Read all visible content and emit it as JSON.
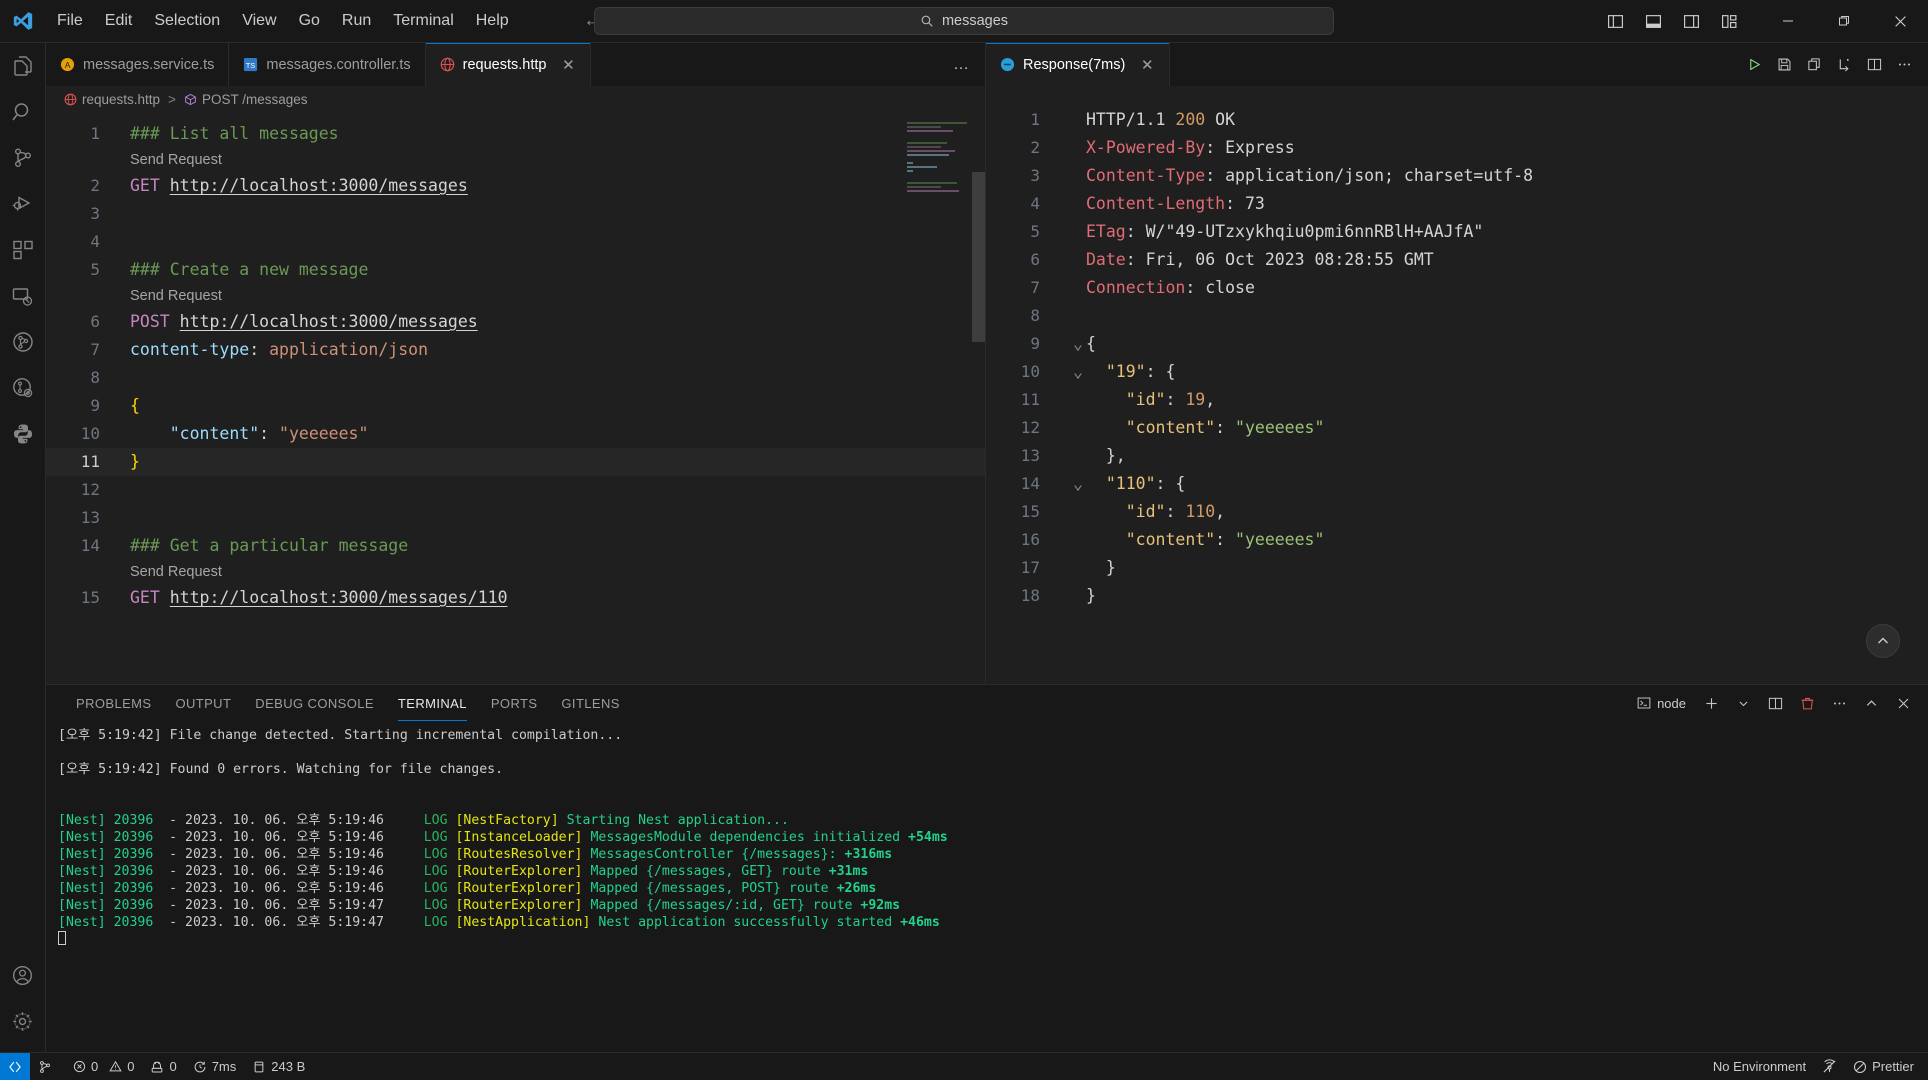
{
  "titlebar": {
    "menus": [
      "File",
      "Edit",
      "Selection",
      "View",
      "Go",
      "Run",
      "Terminal",
      "Help"
    ],
    "nav_back": "←",
    "nav_forward": "→",
    "command_center_text": "messages",
    "layout_icons": [
      "toggle-primary-sidebar",
      "toggle-panel",
      "toggle-secondary-sidebar",
      "customize-layout"
    ],
    "window_controls": {
      "minimize": "—",
      "maximize": "▢",
      "close": "✕"
    }
  },
  "activitybar": {
    "items": [
      {
        "name": "explorer"
      },
      {
        "name": "search"
      },
      {
        "name": "source-control"
      },
      {
        "name": "run-and-debug"
      },
      {
        "name": "extensions"
      },
      {
        "name": "remote-explorer"
      },
      {
        "name": "gitlens"
      },
      {
        "name": "gitlens-inspect"
      },
      {
        "name": "python"
      }
    ],
    "bottom": [
      {
        "name": "accounts"
      },
      {
        "name": "settings"
      }
    ]
  },
  "editor_left": {
    "tabs": [
      {
        "label": "messages.service.ts",
        "icon": "angular-file-icon",
        "active": false,
        "dirty": false
      },
      {
        "label": "messages.controller.ts",
        "icon": "typescript-file-icon",
        "active": false,
        "dirty": false
      },
      {
        "label": "requests.http",
        "icon": "http-file-icon",
        "active": true,
        "close": "✕"
      }
    ],
    "more_actions": "…",
    "breadcrumb": {
      "file": "requests.http",
      "separator": ">",
      "symbol": "POST /messages"
    },
    "lines": [
      {
        "num": "1",
        "codelens": null,
        "tokens": [
          {
            "t": "### List all messages",
            "c": "s-comment"
          }
        ]
      },
      {
        "num": "",
        "codelens": "Send Request",
        "tokens": []
      },
      {
        "num": "2",
        "codelens": null,
        "tokens": [
          {
            "t": "GET ",
            "c": "s-method"
          },
          {
            "t": "http://localhost:3000/messages",
            "c": "s-url"
          }
        ]
      },
      {
        "num": "3",
        "codelens": null,
        "tokens": []
      },
      {
        "num": "4",
        "codelens": null,
        "tokens": []
      },
      {
        "num": "5",
        "codelens": null,
        "tokens": [
          {
            "t": "### Create a new message",
            "c": "s-comment"
          }
        ]
      },
      {
        "num": "",
        "codelens": "Send Request",
        "tokens": []
      },
      {
        "num": "6",
        "codelens": null,
        "tokens": [
          {
            "t": "POST ",
            "c": "s-method"
          },
          {
            "t": "http://localhost:3000/messages",
            "c": "s-url"
          }
        ]
      },
      {
        "num": "7",
        "codelens": null,
        "tokens": [
          {
            "t": "content-type",
            "c": "s-header"
          },
          {
            "t": ": ",
            "c": "s-plain"
          },
          {
            "t": "application/json",
            "c": "s-headerv"
          }
        ]
      },
      {
        "num": "8",
        "codelens": null,
        "tokens": []
      },
      {
        "num": "9",
        "codelens": null,
        "tokens": [
          {
            "t": "{",
            "c": "s-brace"
          }
        ]
      },
      {
        "num": "10",
        "codelens": null,
        "tokens": [
          {
            "t": "    \"content\"",
            "c": "s-key"
          },
          {
            "t": ": ",
            "c": "s-plain"
          },
          {
            "t": "\"yeeeees\"",
            "c": "s-str"
          }
        ]
      },
      {
        "num": "11",
        "codelens": null,
        "current": true,
        "tokens": [
          {
            "t": "}",
            "c": "s-brace"
          }
        ]
      },
      {
        "num": "12",
        "codelens": null,
        "tokens": []
      },
      {
        "num": "13",
        "codelens": null,
        "tokens": []
      },
      {
        "num": "14",
        "codelens": null,
        "tokens": [
          {
            "t": "### Get a particular message",
            "c": "s-comment"
          }
        ]
      },
      {
        "num": "",
        "codelens": "Send Request",
        "tokens": []
      },
      {
        "num": "15",
        "codelens": null,
        "tokens": [
          {
            "t": "GET ",
            "c": "s-method"
          },
          {
            "t": "http://localhost:3000/messages/110",
            "c": "s-url"
          }
        ]
      }
    ]
  },
  "editor_right": {
    "tab": {
      "label": "Response(7ms)",
      "icon": "response-icon",
      "close": "✕"
    },
    "actions": [
      "run-icon",
      "save-icon",
      "copy-icon",
      "fold-icon",
      "split-editor-icon",
      "more-actions-icon"
    ],
    "lines": [
      {
        "num": "1",
        "tokens": [
          {
            "t": "HTTP/1.1 ",
            "c": "s-resp-plain"
          },
          {
            "t": "200",
            "c": "s-resp-num"
          },
          {
            "t": " OK",
            "c": "s-resp-plain"
          }
        ]
      },
      {
        "num": "2",
        "tokens": [
          {
            "t": "X-Powered-By",
            "c": "s-resp-key"
          },
          {
            "t": ": Express",
            "c": "s-resp-plain"
          }
        ]
      },
      {
        "num": "3",
        "tokens": [
          {
            "t": "Content-Type",
            "c": "s-resp-key"
          },
          {
            "t": ": application/json; charset=utf-8",
            "c": "s-resp-plain"
          }
        ]
      },
      {
        "num": "4",
        "tokens": [
          {
            "t": "Content-Length",
            "c": "s-resp-key"
          },
          {
            "t": ": 73",
            "c": "s-resp-plain"
          }
        ]
      },
      {
        "num": "5",
        "tokens": [
          {
            "t": "ETag",
            "c": "s-resp-key"
          },
          {
            "t": ": W/\"49-UTzxykhqiu0pmi6nnRBlH+AAJfA\"",
            "c": "s-resp-plain"
          }
        ]
      },
      {
        "num": "6",
        "tokens": [
          {
            "t": "Date",
            "c": "s-resp-key"
          },
          {
            "t": ": Fri, 06 Oct 2023 08:28:55 GMT",
            "c": "s-resp-plain"
          }
        ]
      },
      {
        "num": "7",
        "tokens": [
          {
            "t": "Connection",
            "c": "s-resp-key"
          },
          {
            "t": ": close",
            "c": "s-resp-plain"
          }
        ]
      },
      {
        "num": "8",
        "tokens": []
      },
      {
        "num": "9",
        "fold": "v",
        "tokens": [
          {
            "t": "{",
            "c": "s-json-punct"
          }
        ]
      },
      {
        "num": "10",
        "fold": "v",
        "tokens": [
          {
            "t": "  \"19\"",
            "c": "s-json-key"
          },
          {
            "t": ": {",
            "c": "s-json-punct"
          }
        ]
      },
      {
        "num": "11",
        "tokens": [
          {
            "t": "    \"id\"",
            "c": "s-json-key"
          },
          {
            "t": ": ",
            "c": "s-json-punct"
          },
          {
            "t": "19",
            "c": "s-json-num"
          },
          {
            "t": ",",
            "c": "s-json-punct"
          }
        ]
      },
      {
        "num": "12",
        "tokens": [
          {
            "t": "    \"content\"",
            "c": "s-json-key"
          },
          {
            "t": ": ",
            "c": "s-json-punct"
          },
          {
            "t": "\"yeeeees\"",
            "c": "s-json-str"
          }
        ]
      },
      {
        "num": "13",
        "tokens": [
          {
            "t": "  },",
            "c": "s-json-punct"
          }
        ]
      },
      {
        "num": "14",
        "fold": "v",
        "tokens": [
          {
            "t": "  \"110\"",
            "c": "s-json-key"
          },
          {
            "t": ": {",
            "c": "s-json-punct"
          }
        ]
      },
      {
        "num": "15",
        "tokens": [
          {
            "t": "    \"id\"",
            "c": "s-json-key"
          },
          {
            "t": ": ",
            "c": "s-json-punct"
          },
          {
            "t": "110",
            "c": "s-json-num"
          },
          {
            "t": ",",
            "c": "s-json-punct"
          }
        ]
      },
      {
        "num": "16",
        "tokens": [
          {
            "t": "    \"content\"",
            "c": "s-json-key"
          },
          {
            "t": ": ",
            "c": "s-json-punct"
          },
          {
            "t": "\"yeeeees\"",
            "c": "s-json-str"
          }
        ]
      },
      {
        "num": "17",
        "tokens": [
          {
            "t": "  }",
            "c": "s-json-punct"
          }
        ]
      },
      {
        "num": "18",
        "tokens": [
          {
            "t": "}",
            "c": "s-json-punct"
          }
        ]
      }
    ]
  },
  "panel": {
    "tabs": [
      {
        "label": "PROBLEMS",
        "active": false
      },
      {
        "label": "OUTPUT",
        "active": false
      },
      {
        "label": "DEBUG CONSOLE",
        "active": false
      },
      {
        "label": "TERMINAL",
        "active": true
      },
      {
        "label": "PORTS",
        "active": false
      },
      {
        "label": "GITLENS",
        "active": false
      }
    ],
    "shell_label": "node",
    "actions": [
      "new-terminal-icon",
      "terminal-dropdown-icon",
      "split-terminal-icon",
      "kill-terminal-icon",
      "more-actions-icon",
      "maximize-panel-icon",
      "close-panel-icon"
    ],
    "terminal_lines": [
      {
        "blank": false,
        "tokens": [
          {
            "t": "[오후 5:19:42] File change detected. Starting incremental compilation...",
            "c": "t-white"
          }
        ]
      },
      {
        "blank": true,
        "tokens": []
      },
      {
        "blank": false,
        "tokens": [
          {
            "t": "[오후 5:19:42] Found 0 errors. Watching for file changes.",
            "c": "t-white"
          }
        ]
      },
      {
        "blank": true,
        "tokens": []
      },
      {
        "blank": true,
        "tokens": []
      },
      {
        "blank": false,
        "tokens": [
          {
            "t": "[Nest] 20396",
            "c": "t-green"
          },
          {
            "t": "  - 2023. 10. 06. 오후 5:19:46     ",
            "c": "t-white"
          },
          {
            "t": "LOG",
            "c": "t-lgreen"
          },
          {
            "t": " [NestFactory] ",
            "c": "t-yellow"
          },
          {
            "t": "Starting Nest application...",
            "c": "t-green"
          }
        ]
      },
      {
        "blank": false,
        "tokens": [
          {
            "t": "[Nest] 20396",
            "c": "t-green"
          },
          {
            "t": "  - 2023. 10. 06. 오후 5:19:46     ",
            "c": "t-white"
          },
          {
            "t": "LOG",
            "c": "t-lgreen"
          },
          {
            "t": " [InstanceLoader] ",
            "c": "t-yellow"
          },
          {
            "t": "MessagesModule dependencies initialized ",
            "c": "t-green"
          },
          {
            "t": "+54ms",
            "c": "t-bgreen"
          }
        ]
      },
      {
        "blank": false,
        "tokens": [
          {
            "t": "[Nest] 20396",
            "c": "t-green"
          },
          {
            "t": "  - 2023. 10. 06. 오후 5:19:46     ",
            "c": "t-white"
          },
          {
            "t": "LOG",
            "c": "t-lgreen"
          },
          {
            "t": " [RoutesResolver] ",
            "c": "t-yellow"
          },
          {
            "t": "MessagesController {/messages}: ",
            "c": "t-green"
          },
          {
            "t": "+316ms",
            "c": "t-bgreen"
          }
        ]
      },
      {
        "blank": false,
        "tokens": [
          {
            "t": "[Nest] 20396",
            "c": "t-green"
          },
          {
            "t": "  - 2023. 10. 06. 오후 5:19:46     ",
            "c": "t-white"
          },
          {
            "t": "LOG",
            "c": "t-lgreen"
          },
          {
            "t": " [RouterExplorer] ",
            "c": "t-yellow"
          },
          {
            "t": "Mapped {/messages, GET} route ",
            "c": "t-green"
          },
          {
            "t": "+31ms",
            "c": "t-bgreen"
          }
        ]
      },
      {
        "blank": false,
        "tokens": [
          {
            "t": "[Nest] 20396",
            "c": "t-green"
          },
          {
            "t": "  - 2023. 10. 06. 오후 5:19:46     ",
            "c": "t-white"
          },
          {
            "t": "LOG",
            "c": "t-lgreen"
          },
          {
            "t": " [RouterExplorer] ",
            "c": "t-yellow"
          },
          {
            "t": "Mapped {/messages, POST} route ",
            "c": "t-green"
          },
          {
            "t": "+26ms",
            "c": "t-bgreen"
          }
        ]
      },
      {
        "blank": false,
        "tokens": [
          {
            "t": "[Nest] 20396",
            "c": "t-green"
          },
          {
            "t": "  - 2023. 10. 06. 오후 5:19:47     ",
            "c": "t-white"
          },
          {
            "t": "LOG",
            "c": "t-lgreen"
          },
          {
            "t": " [RouterExplorer] ",
            "c": "t-yellow"
          },
          {
            "t": "Mapped {/messages/:id, GET} route ",
            "c": "t-green"
          },
          {
            "t": "+92ms",
            "c": "t-bgreen"
          }
        ]
      },
      {
        "blank": false,
        "tokens": [
          {
            "t": "[Nest] 20396",
            "c": "t-green"
          },
          {
            "t": "  - 2023. 10. 06. 오후 5:19:47     ",
            "c": "t-white"
          },
          {
            "t": "LOG",
            "c": "t-lgreen"
          },
          {
            "t": " [NestApplication] ",
            "c": "t-yellow"
          },
          {
            "t": "Nest application successfully started ",
            "c": "t-green"
          },
          {
            "t": "+46ms",
            "c": "t-bgreen"
          }
        ]
      }
    ]
  },
  "statusbar": {
    "remote_icon": "remote-window-icon",
    "left": [
      {
        "name": "branch",
        "icon": "source-control-icon",
        "label": ""
      },
      {
        "name": "problems",
        "icon": "error-warning-icon",
        "errors": "0",
        "warnings": "0"
      },
      {
        "name": "ports",
        "icon": "ports-icon",
        "label": "0"
      },
      {
        "name": "response-time",
        "icon": "clock-icon",
        "label": "7ms"
      },
      {
        "name": "response-size",
        "icon": "database-icon",
        "label": "243 B"
      }
    ],
    "right": [
      {
        "name": "rest-client-environment",
        "label": "No Environment"
      },
      {
        "name": "screencast-mode",
        "icon": "broadcast-off-icon",
        "label": ""
      },
      {
        "name": "prettier",
        "icon": "prettier-check-icon",
        "label": "Prettier"
      }
    ]
  },
  "colors": {
    "accent": "#0078d4",
    "titlebar_bg": "#181818",
    "editor_bg": "#1f1f1f",
    "statusbar_bg": "#181818"
  }
}
